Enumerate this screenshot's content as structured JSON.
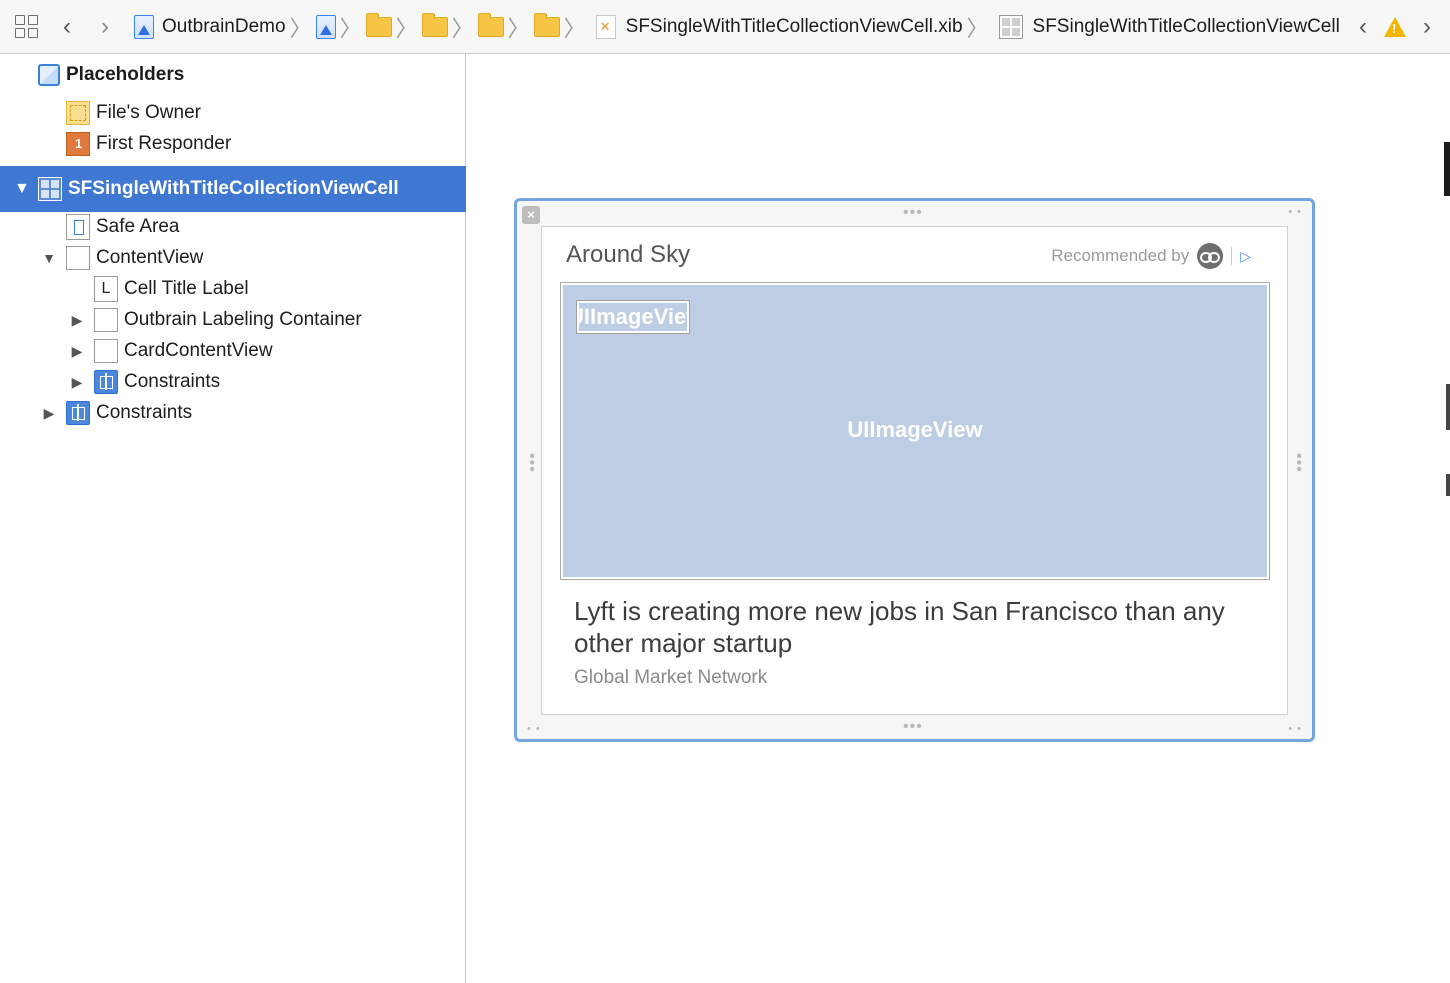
{
  "jumpbar": {
    "project": "OutbrainDemo",
    "file": "SFSingleWithTitleCollectionViewCell.xib",
    "selection": "SFSingleWithTitleCollectionViewCell"
  },
  "outline": {
    "placeholders_header": "Placeholders",
    "files_owner": "File's Owner",
    "first_responder": "First Responder",
    "cell": "SFSingleWithTitleCollectionViewCell",
    "safe_area": "Safe Area",
    "content_view": "ContentView",
    "cell_title_label": "Cell Title Label",
    "label_glyph": "L",
    "outbrain_labeling_container": "Outbrain Labeling Container",
    "card_content_view": "CardContentView",
    "constraints_inner": "Constraints",
    "constraints_outer": "Constraints"
  },
  "canvas": {
    "card_title": "Around Sky",
    "recommended_by": "Recommended by",
    "image_tag": "UIImageView",
    "image_center_label": "UIImageView",
    "headline": "Lyft is creating more new jobs in San Francisco  than any other major startup",
    "source": "Global Market Network"
  },
  "colors": {
    "selection": "#3f78d2",
    "frame_border": "#74a5df",
    "image_fill": "#bdcde3"
  }
}
